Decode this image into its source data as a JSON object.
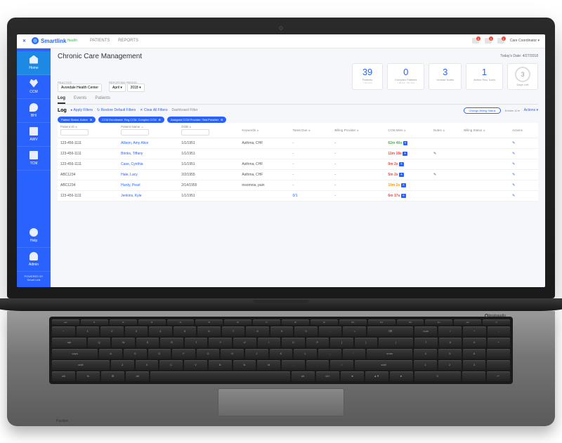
{
  "brand": {
    "name": "Smartlink",
    "sub": "Health"
  },
  "topnav": [
    {
      "label": "PATIENTS"
    },
    {
      "label": "REPORTS"
    }
  ],
  "badges": [
    "3",
    "3",
    "1"
  ],
  "user_menu": "Care Coordinator ▾",
  "date_label": "Today's Date: 4/27/2018",
  "sidebar": [
    {
      "label": "Home",
      "icon": "home"
    },
    {
      "label": "CCM",
      "icon": "heart"
    },
    {
      "label": "BHI",
      "icon": "phone"
    },
    {
      "label": "AWV",
      "icon": "cal"
    },
    {
      "label": "TCM",
      "icon": "tcm"
    },
    {
      "label": "Help",
      "icon": "help"
    },
    {
      "label": "Admin",
      "icon": "admin"
    }
  ],
  "sidebar_foot": {
    "p": "POWERED BY",
    "b": "Smart Link"
  },
  "page_title": "Chronic Care Management",
  "filters": {
    "practice_label": "PRACTICE",
    "practice": "Avondale Health Center",
    "period_label": "REPORTING PERIOD",
    "month": "April",
    "year": "2018"
  },
  "stats": [
    {
      "n": "39",
      "l": "Patients",
      "s": "> 20 mins"
    },
    {
      "n": "0",
      "l": "Complex Patients",
      "s": "> 59 but < 89 mins"
    },
    {
      "n": "3",
      "l": "Unread Notes",
      "s": ""
    },
    {
      "n": "1",
      "l": "Action Req. Docs",
      "s": ""
    },
    {
      "n": "3",
      "l": "Days Left",
      "s": "",
      "days": true
    }
  ],
  "tabs": [
    {
      "label": "Log",
      "active": true
    },
    {
      "label": "Events"
    },
    {
      "label": "Patients"
    }
  ],
  "log_label": "Log",
  "log_links": {
    "apply": "▸ Apply Filters",
    "restore": "↻ Restore Default Filters",
    "clear": "✕ Clear All Filters",
    "dash": "Dashboard Filter"
  },
  "chips": [
    {
      "l": "Patient Status: Active"
    },
    {
      "l": "CCM Enrollment: Reg CCM, Complex CCM"
    },
    {
      "l": "Assigned CCM Provider: Test Provider"
    }
  ],
  "change_status": "Change Billing Status",
  "entries": "Entries 10 ▾",
  "actions_link": "Actions ▾",
  "cols": [
    "Patient ID",
    "Patient Name",
    "DOB",
    "Keywords",
    "Tasks Due",
    "Billing Provider",
    "CCM Mins",
    "Notes",
    "Billing Status",
    "Actions"
  ],
  "rows": [
    {
      "id": "123-456-1111",
      "name": "Allison, Amy Alice",
      "dob": "1/1/1951",
      "kw": "Asthma, CHF",
      "tasks": "-",
      "bp": "-",
      "mins": "62m 40s",
      "mcl": "mg",
      "notes": "",
      "bs": "",
      "act": "✎"
    },
    {
      "id": "123-456-1111",
      "name": "Brinks, Tiffany",
      "dob": "1/1/1951",
      "kw": "",
      "tasks": "-",
      "bp": "-",
      "mins": "11m 18s",
      "mcl": "mr",
      "notes": "✎",
      "bs": "",
      "act": "✎"
    },
    {
      "id": "123-456-1111",
      "name": "Case, Cynthia",
      "dob": "1/1/1951",
      "kw": "Asthma, CHF",
      "tasks": "-",
      "bp": "-",
      "mins": "0m 2s",
      "mcl": "mr",
      "notes": "",
      "bs": "",
      "act": "✎"
    },
    {
      "id": "ABC1234",
      "name": "Hale, Lacy",
      "dob": "2/2/1955",
      "kw": "Asthma, CHF",
      "tasks": "-",
      "bp": "-",
      "mins": "5m 2s",
      "mcl": "mr",
      "notes": "✎",
      "bs": "",
      "act": "✎"
    },
    {
      "id": "ABC1234",
      "name": "Hurdy, Pearl",
      "dob": "2/14/1955",
      "kw": "insomnia, pain",
      "tasks": "-",
      "bp": "-",
      "mins": "10m 2s",
      "mcl": "mo",
      "notes": "",
      "bs": "",
      "act": "✎"
    },
    {
      "id": "123-456-1111",
      "name": "Jenkins, Kyle",
      "dob": "1/1/1951",
      "kw": "",
      "tasks": "0/1",
      "bp": "-",
      "mins": "6m 17s",
      "mcl": "mr",
      "notes": "",
      "bs": "",
      "act": "✎"
    }
  ],
  "hw": {
    "beats": "beatsaudio",
    "pav": "Pavilion"
  },
  "kbd": {
    "r1": [
      "Q",
      "W",
      "E",
      "R",
      "T",
      "Y",
      "U",
      "I",
      "O",
      "P",
      "{",
      "}",
      "|"
    ],
    "r2": [
      "A",
      "S",
      "D",
      "F",
      "G",
      "H",
      "J",
      "K",
      "L",
      ";",
      "'"
    ],
    "r3": [
      "Z",
      "X",
      "C",
      "V",
      "B",
      "N",
      "M",
      ",",
      ".",
      "/"
    ]
  }
}
